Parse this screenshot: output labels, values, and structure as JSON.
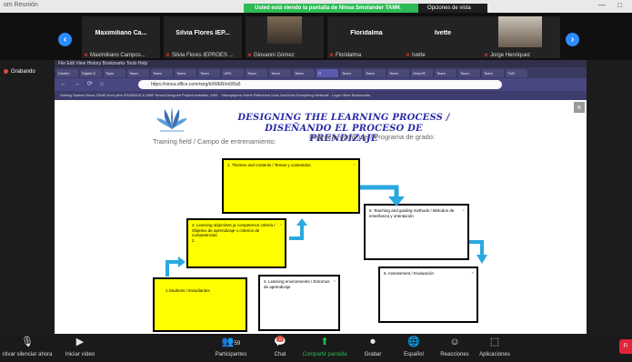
{
  "window": {
    "title": "om Reunión",
    "share_banner": "Usted está viendo la pantalla de Ninoa Smolander TAMK",
    "view_options": "Opciones de vista",
    "controls": [
      "—",
      "□"
    ]
  },
  "participants": [
    {
      "display": "Maximiliano Ca...",
      "footer": "Maximiliano Campos..."
    },
    {
      "display": "Silvia Flores IEP...",
      "footer": "Silvia Flores IEPROES ..."
    },
    {
      "display": "",
      "footer": "Giovanni Gómez"
    },
    {
      "display": "Floridalma",
      "footer": "Floridalma"
    },
    {
      "display": "Ivette",
      "footer": "Ivette"
    },
    {
      "display": "",
      "footer": "Jorge Henriquez"
    }
  ],
  "recording": {
    "label": "Grabando"
  },
  "browser": {
    "menu": "File  Edit  View  History  Bookmarks  Tools  Help",
    "tabs": [
      "Diseño",
      "Digital D",
      "Topic",
      "Team",
      "Team",
      "Team",
      "Team",
      "UPD",
      "Team",
      "Team",
      "Team",
      "O",
      "Team",
      "Team",
      "Team",
      "OnlyOff",
      "Team",
      "Team",
      "Team",
      "TUE"
    ],
    "nav": "← → ⟳ ⌂",
    "url": "https://ninoa.office.com/rwrg/kt/WEB/m0/5a5",
    "bookmarks": "Getting Started   Ninoa   TAMK   Norrl pilot   ERASMUS & MMF   Ninoa   Designed   Project websites, EdR...   Newspapers   Home   Reference tools   OneDrive   Everything   Webmail - Login   Other Bookmarks"
  },
  "document": {
    "title1": "DESIGNING THE LEARNING PROCESS /",
    "title2": "DISEÑANDO EL PROCESO DE PRENDIZAJE",
    "training_field": "Training field / Campo de entrenamiento:",
    "degree": "Degree/programme / Programa de grado:",
    "boxes": {
      "themes": "1. Themes and contents / Temas y contenidos",
      "objectives": "2. Learning objectives ja competence criteria / Objetivo de aprendizaje o criterios de competencias",
      "objectives_mark": "2.",
      "students": "1.Students / Estudiantes",
      "environments": "4. Learning environments / Entornos de aprendizaje",
      "teaching": "5. Teaching and guiding methods / Métodos de enseñanza y orientación",
      "assessment": "5. Assessment / Evaluación"
    },
    "corner_mark": "×",
    "close": "×"
  },
  "toolbar": {
    "mute": "ctivar silenciar ahora",
    "video": "Iniciar vídeo",
    "participants": "Participantes",
    "participants_count": "59",
    "chat": "Chat",
    "chat_badge": "11",
    "share": "Compartir pantalla",
    "record": "Grabar",
    "spanish": "Español",
    "reactions": "Reacciones",
    "apps": "Aplicaciones",
    "end": "Fi"
  },
  "colors": {
    "share_green": "#2cbb55",
    "accent_blue": "#2d8cff",
    "title_blue": "#2a2aa8",
    "arrow_blue": "#29a8e0",
    "box_yellow": "#ffff00",
    "end_red": "#e0243a"
  }
}
